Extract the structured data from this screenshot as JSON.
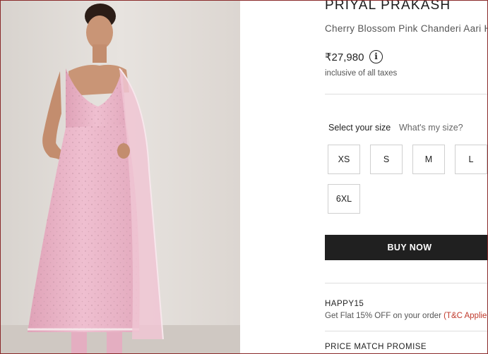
{
  "product": {
    "brand": "PRIYAL PRAKASH",
    "name": "Cherry Blossom Pink Chanderi Aari Ho",
    "price": "₹27,980",
    "info_icon": "info-icon",
    "tax_note": "inclusive of all taxes"
  },
  "size": {
    "label": "Select your size",
    "guide_link": "What's my size?",
    "options": [
      "XS",
      "S",
      "M",
      "L",
      "6XL"
    ]
  },
  "actions": {
    "buy_now": "BUY NOW"
  },
  "offer": {
    "code": "HAPPY15",
    "text": "Get Flat 15% OFF on your order ",
    "link": "(T&C Applied"
  },
  "price_match": {
    "title": "PRICE MATCH PROMISE"
  },
  "colors": {
    "dress_pink": "#eab4c8",
    "button_dark": "#202020",
    "link_red": "#c0392b"
  }
}
